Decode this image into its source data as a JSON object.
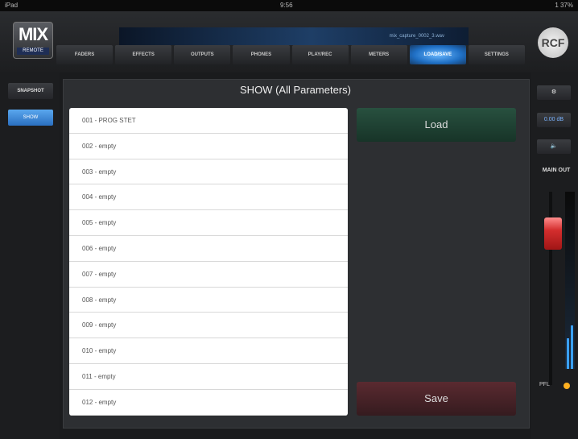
{
  "status": {
    "left": "iPad",
    "center": "9:56",
    "right": "1 37%"
  },
  "logo": {
    "main": "MIX",
    "sub": "REMOTE"
  },
  "track_name": "mix_capture_0002_3.wav",
  "tabs": [
    "FADERS",
    "EFFECTS",
    "OUTPUTS",
    "PHONES",
    "PLAY/REC",
    "METERS",
    "LOAD/SAVE",
    "SETTINGS"
  ],
  "active_tab_index": 6,
  "brand": "RCF",
  "left": {
    "snapshot": "SNAPSHOT",
    "selected": "SHOW"
  },
  "panel": {
    "title": "SHOW (All Parameters)",
    "items": [
      "001 - PROG STET",
      "002 - empty",
      "003 - empty",
      "004 - empty",
      "005 - empty",
      "006 - empty",
      "007 - empty",
      "008 - empty",
      "009 - empty",
      "010 - empty",
      "011 - empty",
      "012 - empty"
    ],
    "load": "Load",
    "save": "Save"
  },
  "right": {
    "gain": "0.00 dB",
    "main_out": "MAIN OUT",
    "pfl": "PFL"
  }
}
